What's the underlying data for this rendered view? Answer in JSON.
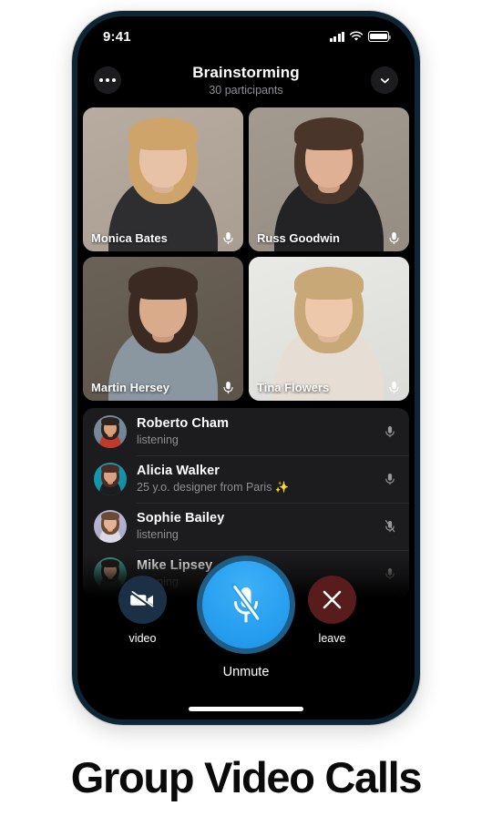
{
  "caption": "Group Video Calls",
  "status_bar": {
    "time": "9:41",
    "signal_icon": "cellular-signal-icon",
    "wifi_icon": "wifi-icon",
    "battery_icon": "battery-full-icon"
  },
  "header": {
    "title": "Brainstorming",
    "subtitle": "30 participants",
    "more_icon": "more-options-icon",
    "collapse_icon": "chevron-down-icon"
  },
  "colors": {
    "accent_blue": "#29a0f0",
    "ring_blue": "#1f5d87",
    "speaking_green": "#49ba6b",
    "leave_red": "#591c1c",
    "video_navy": "#1b3045",
    "panel_bg": "#1c1c1e",
    "screen_bg": "#000000",
    "frame_bezel": "#0e2634",
    "secondary_text": "#8e8e93"
  },
  "video_tiles": [
    {
      "name": "Monica Bates",
      "mic_icon": "microphone-icon",
      "muted": false,
      "speaking": false,
      "skin": "#e8c2a6",
      "hair": "#cfa46a",
      "cloth": "#2e2e31",
      "bg": "#b8aca0"
    },
    {
      "name": "Russ Goodwin",
      "mic_icon": "microphone-icon",
      "muted": false,
      "speaking": false,
      "skin": "#e0b094",
      "hair": "#4a352a",
      "cloth": "#232326",
      "bg": "#a39a90"
    },
    {
      "name": "Martin Hersey",
      "mic_icon": "microphone-icon",
      "muted": false,
      "speaking": false,
      "skin": "#d9ab8c",
      "hair": "#3b2a22",
      "cloth": "#8a96a0",
      "bg": "#6b6257"
    },
    {
      "name": "Tina Flowers",
      "mic_icon": "microphone-icon",
      "muted": false,
      "speaking": true,
      "skin": "#edc8ab",
      "hair": "#c9a877",
      "cloth": "#e6ded5",
      "bg": "#e9eae6"
    }
  ],
  "participants": [
    {
      "name": "Roberto Cham",
      "status": "listening",
      "mic_icon": "microphone-icon",
      "muted": false,
      "avatar_name": "avatar-roberto-cham",
      "skin": "#d9a07c",
      "hair": "#2a2320",
      "cloth": "#c0392b",
      "bg": "#7b8f9e"
    },
    {
      "name": "Alicia Walker",
      "status": "25 y.o. designer from Paris ✨",
      "mic_icon": "microphone-icon",
      "muted": false,
      "avatar_name": "avatar-alicia-walker",
      "skin": "#dba185",
      "hair": "#4a2c22",
      "cloth": "#1d1d20",
      "bg": "#1b9ab0"
    },
    {
      "name": "Sophie Bailey",
      "status": "listening",
      "mic_icon": "microphone-muted-icon",
      "muted": true,
      "avatar_name": "avatar-sophie-bailey",
      "skin": "#e2b394",
      "hair": "#6b4a33",
      "cloth": "#ded9e6",
      "bg": "#b9b6d6"
    },
    {
      "name": "Mike Lipsey",
      "status": "listening",
      "mic_icon": "microphone-icon",
      "muted": false,
      "avatar_name": "avatar-mike-lipsey",
      "skin": "#c99a78",
      "hair": "#1f1a17",
      "cloth": "#2c3a38",
      "bg": "#3f8f84"
    }
  ],
  "controls": {
    "video": {
      "label": "video",
      "icon": "video-off-icon"
    },
    "mute": {
      "label": "Unmute",
      "icon": "microphone-muted-icon"
    },
    "leave": {
      "label": "leave",
      "icon": "close-x-icon"
    }
  }
}
